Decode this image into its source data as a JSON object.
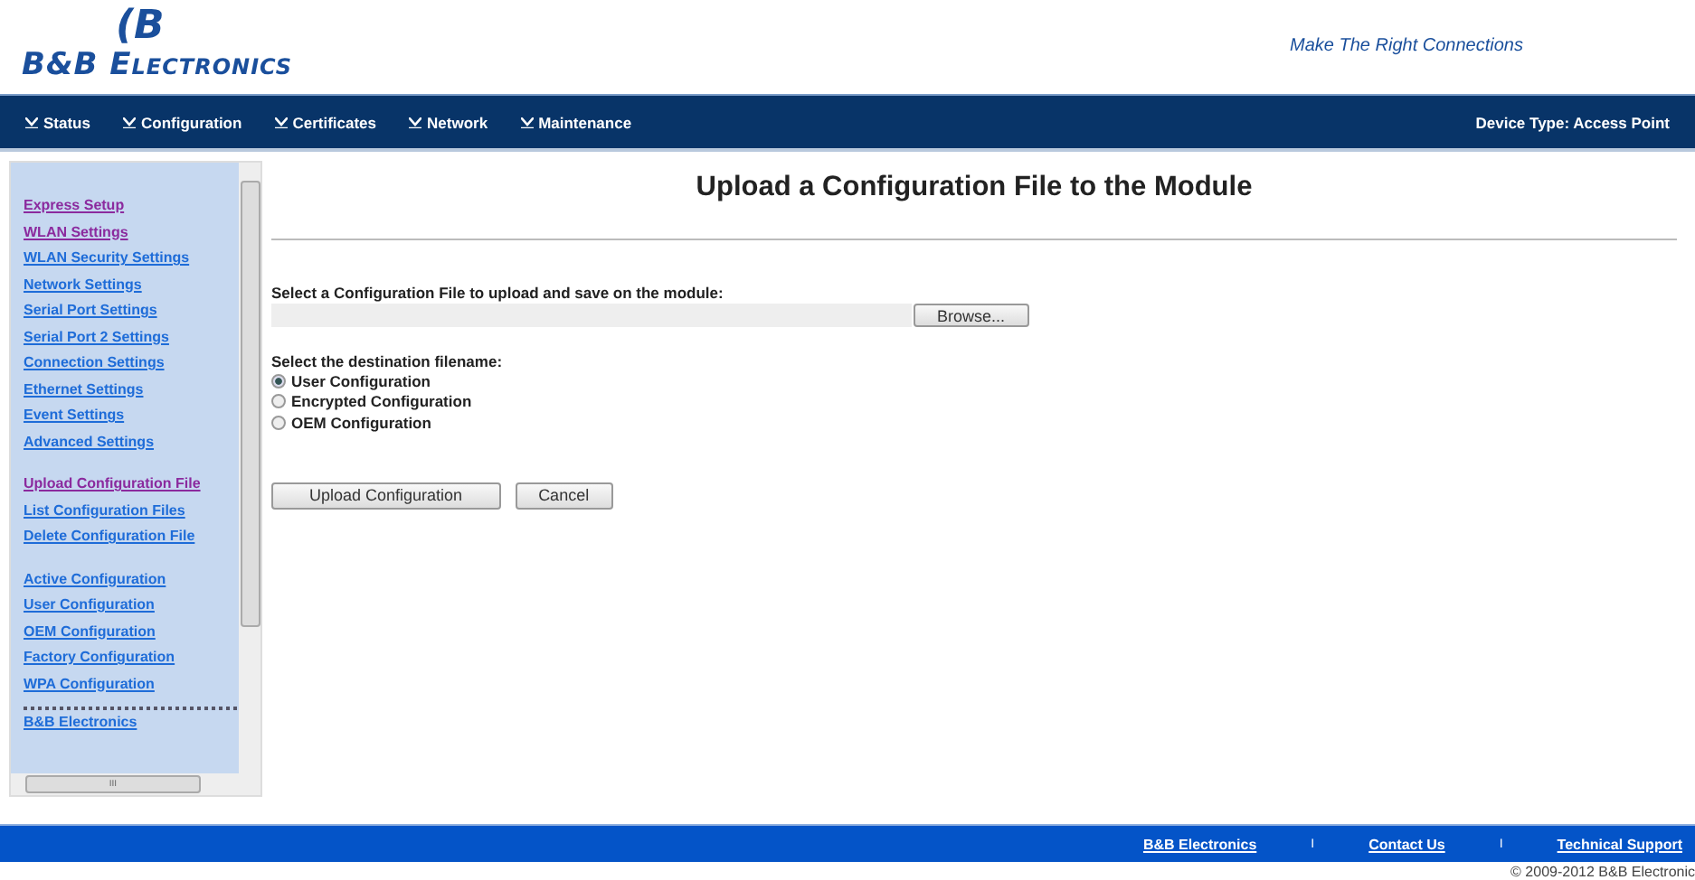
{
  "header": {
    "logo_mark": "(B",
    "logo_text": "B&B Electronics",
    "tagline": "Make The Right Connections"
  },
  "nav": {
    "items": [
      {
        "label": "Status"
      },
      {
        "label": "Configuration"
      },
      {
        "label": "Certificates"
      },
      {
        "label": "Network"
      },
      {
        "label": "Maintenance"
      }
    ],
    "device_type": "Device Type: Access Point"
  },
  "sidebar": {
    "groups": [
      [
        {
          "label": "Express Setup",
          "visited": true
        },
        {
          "label": "WLAN Settings",
          "visited": true
        },
        {
          "label": "WLAN Security Settings",
          "visited": false
        },
        {
          "label": "Network Settings",
          "visited": false
        },
        {
          "label": "Serial Port Settings",
          "visited": false
        },
        {
          "label": "Serial Port 2 Settings",
          "visited": false
        },
        {
          "label": "Connection Settings",
          "visited": false
        },
        {
          "label": "Ethernet Settings",
          "visited": false
        },
        {
          "label": "Event Settings",
          "visited": false
        },
        {
          "label": "Advanced Settings",
          "visited": false
        }
      ],
      [
        {
          "label": "Upload Configuration File",
          "visited": true
        },
        {
          "label": "List Configuration Files",
          "visited": false
        },
        {
          "label": "Delete Configuration File",
          "visited": false
        }
      ],
      [
        {
          "label": "Active Configuration",
          "visited": false
        },
        {
          "label": "User Configuration",
          "visited": false
        },
        {
          "label": "OEM Configuration",
          "visited": false
        },
        {
          "label": "Factory Configuration",
          "visited": false
        },
        {
          "label": "WPA Configuration",
          "visited": false
        }
      ]
    ],
    "bottom_link": "B&B Electronics",
    "hscroll_grip": "III"
  },
  "main": {
    "title": "Upload a Configuration File to the Module",
    "file_label": "Select a Configuration File to upload and save on the module:",
    "browse": "Browse...",
    "dest_label": "Select the destination filename:",
    "options": [
      {
        "label": "User Configuration",
        "selected": true
      },
      {
        "label": "Encrypted Configuration",
        "selected": false
      },
      {
        "label": "OEM Configuration",
        "selected": false
      }
    ],
    "buttons": [
      "Upload Configuration",
      "Cancel"
    ]
  },
  "footer": {
    "links": [
      "B&B Electronics",
      "Contact Us",
      "Technical Support"
    ],
    "separators": [
      "I",
      "I"
    ],
    "copyright": "© 2009-2012 B&B Electronic"
  }
}
